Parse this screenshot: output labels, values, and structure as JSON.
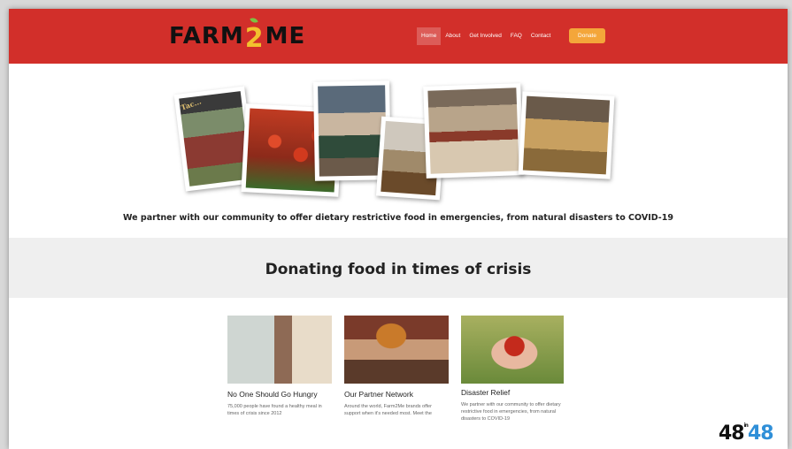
{
  "header": {
    "logo_left": "FARM",
    "logo_mid": "2",
    "logo_right": "ME",
    "nav": [
      "Home",
      "About",
      "Get Involved",
      "FAQ",
      "Contact"
    ],
    "donate": "Donate",
    "color": "#d22f2a"
  },
  "collage": {
    "sign_text": "Tac..."
  },
  "tagline": "We partner with our community to offer dietary restrictive food in emergencies, from natural disasters to COVID-19",
  "band": {
    "title": "Donating food in times of crisis"
  },
  "cards": [
    {
      "title": "No One Should Go Hungry",
      "text": "75,000 people have found a healthy meal in times of crisis since 2012"
    },
    {
      "title": "Our Partner Network",
      "text": "Around the world, Farm2Me brands offer support when it's needed most. Meet the"
    },
    {
      "title": "Disaster Relief",
      "text": "We partner with our community to offer dietary restrictive food in emergencies, from natural disasters to COVID-19"
    }
  ],
  "watermark": {
    "left": "48",
    "mid": "in",
    "right": "48"
  }
}
